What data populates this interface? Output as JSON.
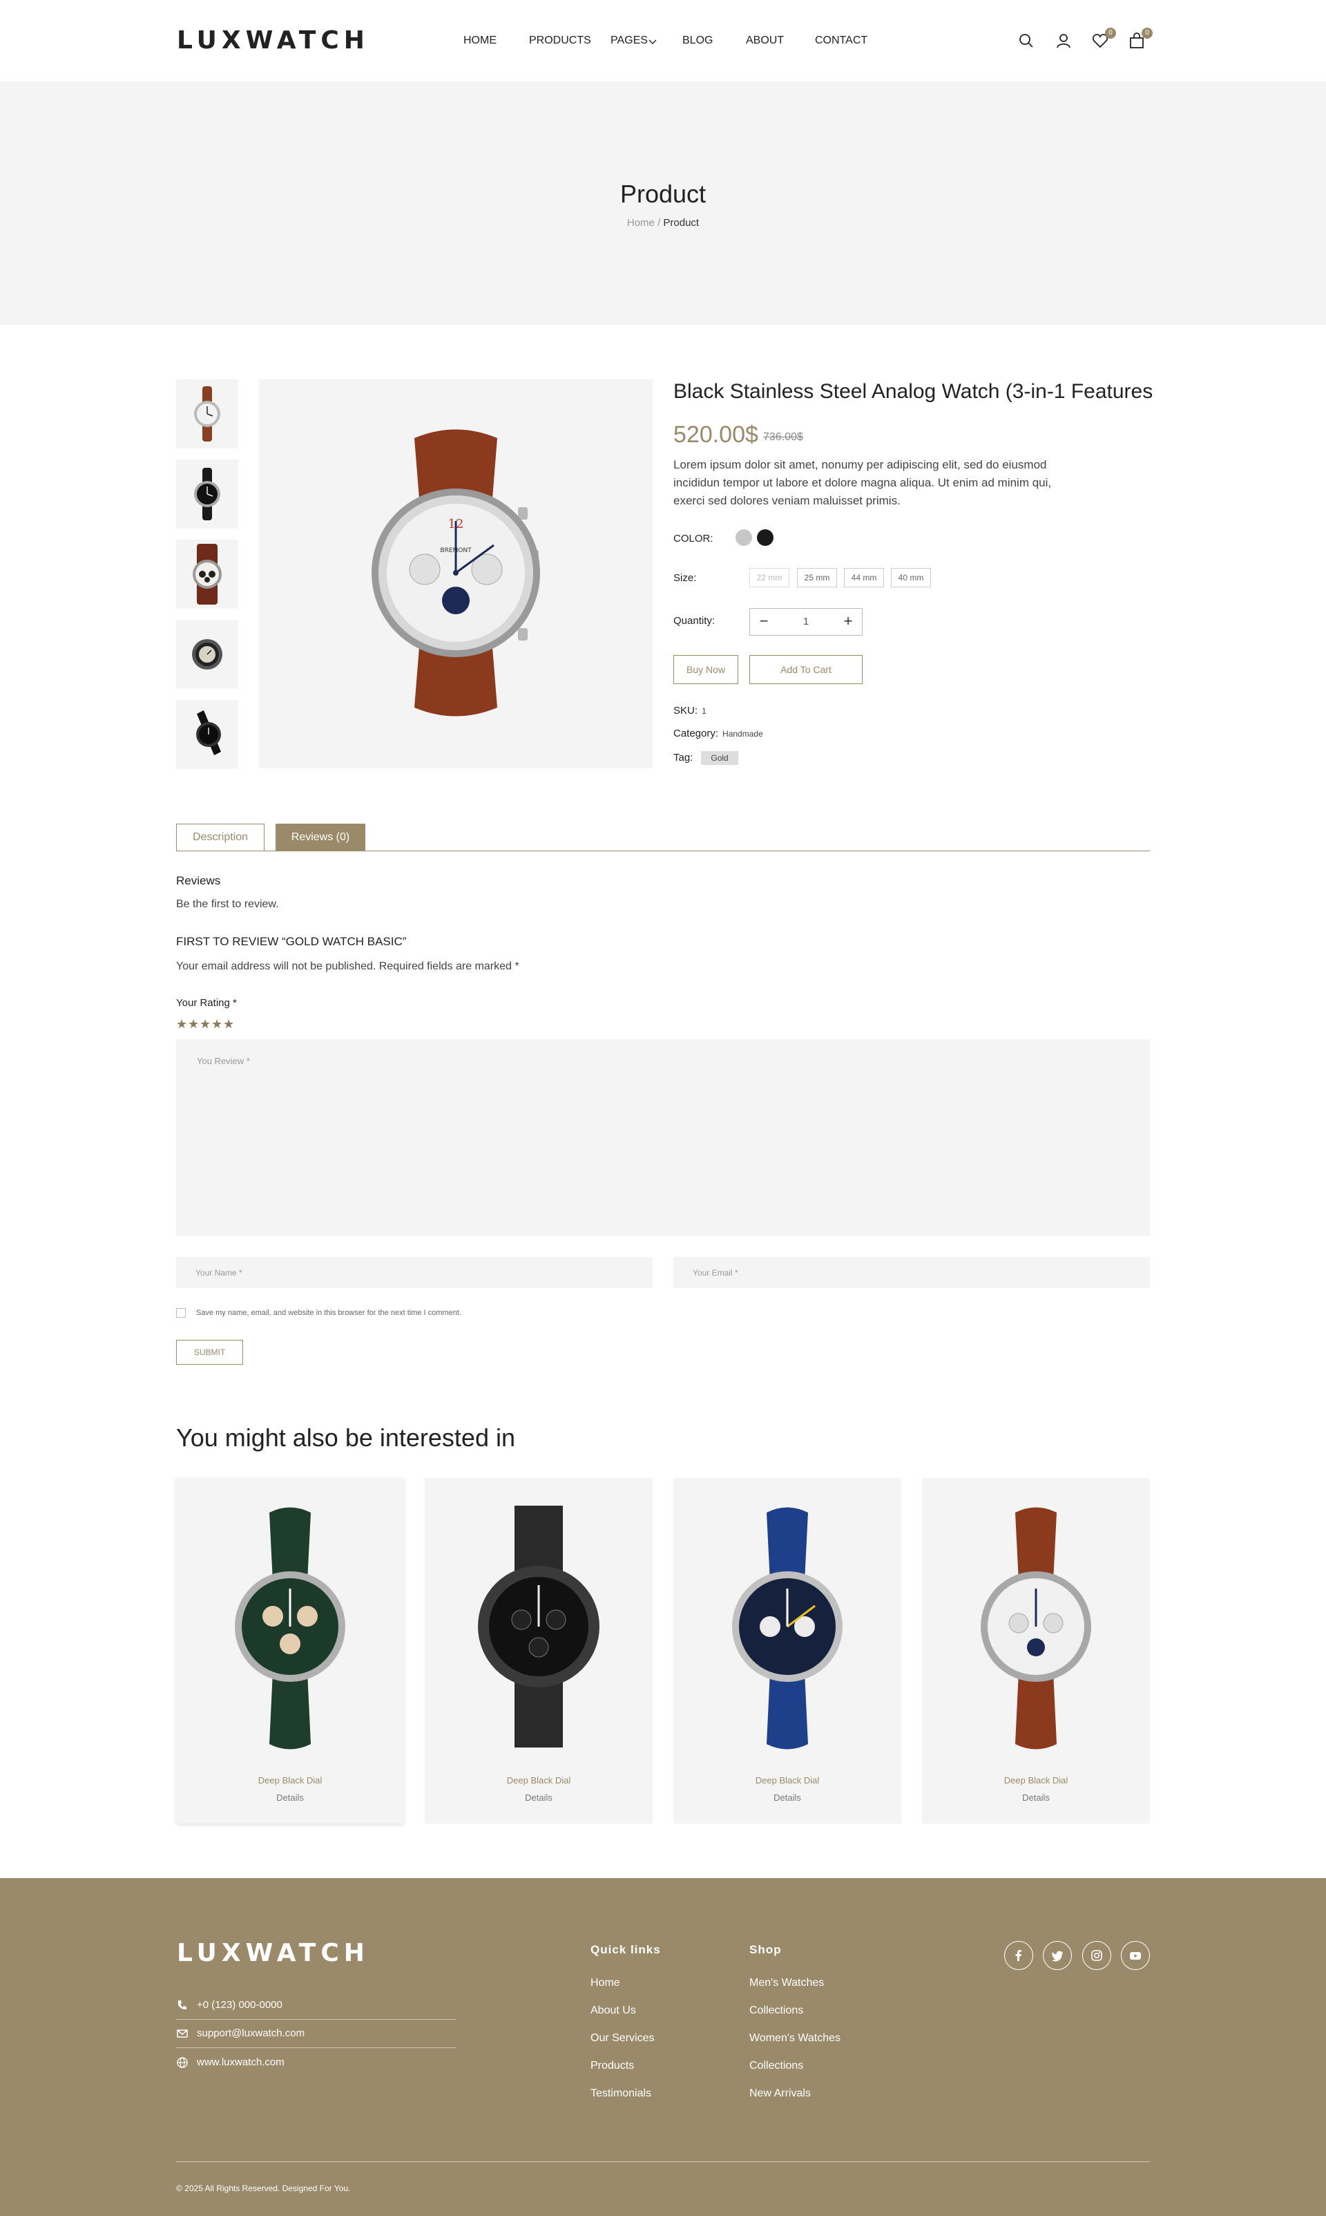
{
  "header": {
    "logo": "LUXWATCH",
    "nav": [
      "HOME",
      "PRODUCTS",
      "PAGES",
      "BLOG",
      "ABOUT",
      "CONTACT"
    ],
    "wishlist_count": "0",
    "cart_count": "0"
  },
  "hero": {
    "title": "Product",
    "breadcrumb_home": "Home",
    "breadcrumb_sep": "/",
    "breadcrumb_current": "Product"
  },
  "product": {
    "title": "Black Stainless Steel Analog Watch (3-in-1 Features",
    "price": "520.00$",
    "old_price": "736.00$",
    "description": "Lorem ipsum dolor sit amet, nonumy per adipiscing elit, sed do eiusmod incididun tempor ut labore et dolore magna aliqua. Ut enim ad minim qui, exerci sed dolores veniam maluisset primis.",
    "color_label": "COLOR:",
    "size_label": "Size:",
    "sizes": [
      "22 mm",
      "25 mm",
      "44 mm",
      "40 mm"
    ],
    "quantity_label": "Quantity:",
    "quantity": "1",
    "buy_now": "Buy Now",
    "add_to_cart": "Add To Cart",
    "sku_label": "SKU:",
    "sku": "1",
    "category_label": "Category:",
    "category": "Handmade",
    "tag_label": "Tag:",
    "tag": "Gold",
    "accent_color": "#9b8a6a"
  },
  "tabs": {
    "description": "Description",
    "reviews": "Reviews (0)"
  },
  "reviews": {
    "heading": "Reviews",
    "empty": "Be the first to review.",
    "form_title": "FIRST TO REVIEW “GOLD WATCH BASIC”",
    "notice": "Your email address will not be published. Required fields are marked *",
    "rating_label": "Your Rating *",
    "stars": 5,
    "review_placeholder": "You Review *",
    "name_placeholder": "Your Name *",
    "email_placeholder": "Your Email *",
    "save_text": "Save my name, email, and website in this browser for the next time I comment.",
    "submit": "SUBMIT"
  },
  "related": {
    "title": "You might also be interested in",
    "items": [
      {
        "name": "Deep Black Dial",
        "details": "Details"
      },
      {
        "name": "Deep Black Dial",
        "details": "Details"
      },
      {
        "name": "Deep Black Dial",
        "details": "Details"
      },
      {
        "name": "Deep Black Dial",
        "details": "Details"
      }
    ]
  },
  "footer": {
    "logo": "LUXWATCH",
    "phone": "+0 (123) 000-0000",
    "email": "support@luxwatch.com",
    "website": "www.luxwatch.com",
    "quick_links_title": "Quick links",
    "quick_links": [
      "Home",
      "About Us",
      "Our Services",
      "Products",
      "Testimonials"
    ],
    "shop_title": "Shop",
    "shop_links": [
      "Men's Watches",
      "Collections",
      "Women's Watches",
      "Collections",
      "New Arrivals"
    ],
    "copyright": "© 2025 All Rights Reserved. Designed For You."
  }
}
